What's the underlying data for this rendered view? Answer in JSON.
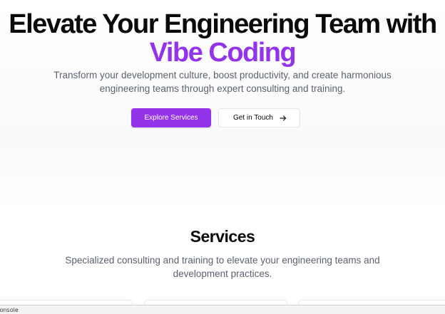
{
  "hero": {
    "title_line1": "Elevate Your Engineering Team with",
    "title_line2": "Vibe Coding",
    "subtitle": "Transform your development culture, boost productivity, and create harmonious engineering teams through expert consulting and training.",
    "primary_cta": "Explore Services",
    "secondary_cta": "Get in Touch",
    "secondary_cta_icon": "arrow-right-icon"
  },
  "services": {
    "title": "Services",
    "subtitle": "Specialized consulting and training to elevate your engineering teams and development practices."
  },
  "devtools": {
    "tab_label": "Console"
  },
  "colors": {
    "accent": "#9333ea",
    "text_muted": "#5b6170",
    "text_dark": "#0a0a0a"
  }
}
